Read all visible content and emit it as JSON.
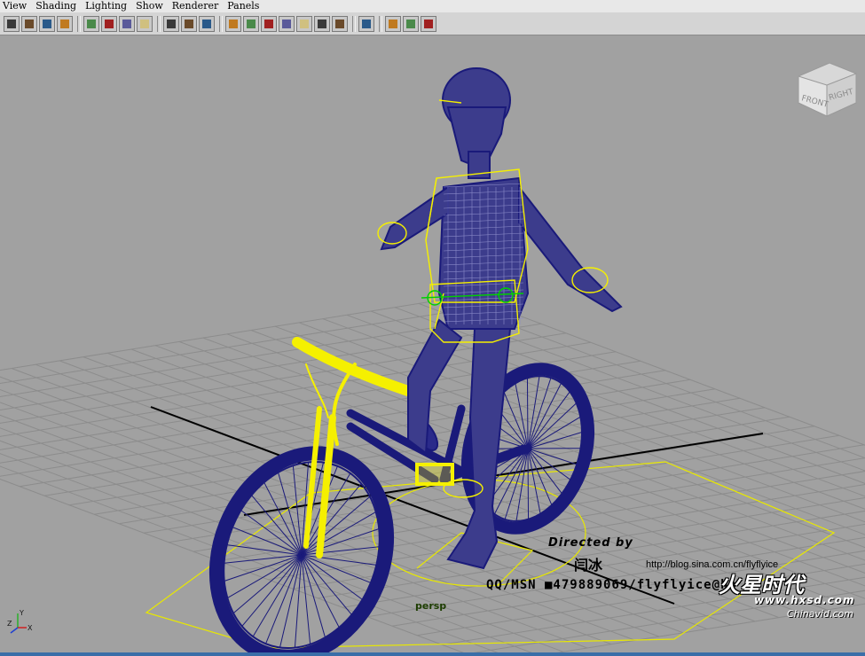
{
  "menu": {
    "items": [
      "View",
      "Shading",
      "Lighting",
      "Show",
      "Renderer",
      "Panels"
    ]
  },
  "toolbar": {
    "icons": [
      "select-camera-icon",
      "lock-camera-icon",
      "bookmarks-icon",
      "image-plane-icon",
      "separator",
      "grid-icon",
      "film-gate-icon",
      "resolution-gate-icon",
      "safe-action-icon",
      "separator",
      "field-chart-icon",
      "gate-mask-icon",
      "heads-up-display-icon",
      "separator",
      "wireframe-icon",
      "smooth-shade-icon",
      "textured-icon",
      "shadows-icon",
      "use-lights-icon",
      "xray-icon",
      "xray-joints-icon",
      "separator",
      "isolate-select-icon",
      "separator",
      "two-sided-lighting-icon",
      "backface-culling-icon",
      "render-icon"
    ]
  },
  "viewport": {
    "camera_name": "persp",
    "viewcube": {
      "front_label": "FRONT",
      "right_label": "RIGHT"
    },
    "axis": {
      "y": "Y",
      "z": "Z",
      "x": "X"
    }
  },
  "watermark": {
    "directed_by": "Directed by",
    "author": "闫冰",
    "blog": "http://blog.sina.com.cn/flyflyice",
    "contact": "QQ/MSN ■479889069/flyflyice@ho",
    "logo": "火星时代",
    "site": "www.hxsd.com",
    "site2": "Chinavid.com"
  },
  "colors": {
    "viewport_bg": "#a1a1a1",
    "wire_blue": "#1a1a7a",
    "wire_yellow": "#f5f000",
    "grid_line": "#8c8c8c",
    "grid_axis": "#000000",
    "ui_panel": "#d4d4d4"
  }
}
